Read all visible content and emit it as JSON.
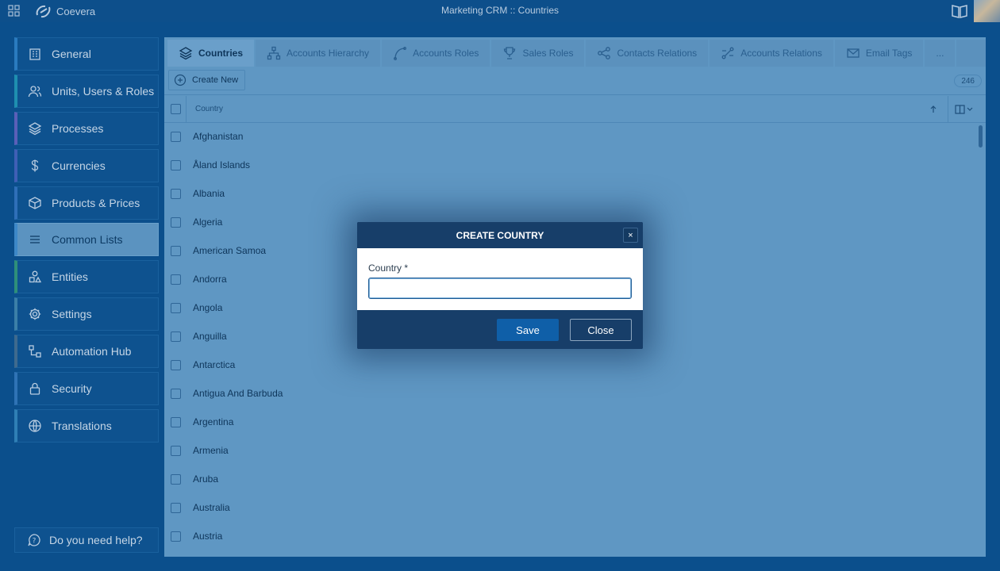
{
  "app": {
    "brand": "Coevera",
    "window_title": "Marketing CRM :: Countries"
  },
  "sidebar": {
    "items": [
      {
        "label": "General",
        "icon": "building-icon",
        "accent": "#2a7bbf"
      },
      {
        "label": "Units, Users & Roles",
        "icon": "users-icon",
        "accent": "#1e8fb0"
      },
      {
        "label": "Processes",
        "icon": "layers-icon",
        "accent": "#5a5fb8"
      },
      {
        "label": "Currencies",
        "icon": "dollar-icon",
        "accent": "#3f5fb5"
      },
      {
        "label": "Products & Prices",
        "icon": "box-icon",
        "accent": "#2f6fb8"
      },
      {
        "label": "Common Lists",
        "icon": "list-icon",
        "accent": "#3d88c8"
      },
      {
        "label": "Entities",
        "icon": "shapes-icon",
        "accent": "#2e8f7a"
      },
      {
        "label": "Settings",
        "icon": "gear-icon",
        "accent": "#3b7fa8"
      },
      {
        "label": "Automation Hub",
        "icon": "workflow-icon",
        "accent": "#3e6a8e"
      },
      {
        "label": "Security",
        "icon": "lock-icon",
        "accent": "#2f73b5"
      },
      {
        "label": "Translations",
        "icon": "globe-icon",
        "accent": "#2f7fb5"
      }
    ],
    "active_index": 5,
    "help_label": "Do you need help?"
  },
  "tabs": [
    {
      "label": "Countries",
      "icon": "layers-icon"
    },
    {
      "label": "Accounts Hierarchy",
      "icon": "hierarchy-icon"
    },
    {
      "label": "Accounts Roles",
      "icon": "curve-icon"
    },
    {
      "label": "Sales Roles",
      "icon": "trophy-icon"
    },
    {
      "label": "Contacts Relations",
      "icon": "share-icon"
    },
    {
      "label": "Accounts Relations",
      "icon": "relation-icon"
    },
    {
      "label": "Email Tags",
      "icon": "mail-icon"
    },
    {
      "label": "...",
      "icon": ""
    }
  ],
  "toolbar": {
    "create_label": "Create New",
    "count": "246"
  },
  "grid": {
    "column_header": "Country",
    "rows": [
      "Afghanistan",
      "Åland Islands",
      "Albania",
      "Algeria",
      "American Samoa",
      "Andorra",
      "Angola",
      "Anguilla",
      "Antarctica",
      "Antigua And Barbuda",
      "Argentina",
      "Armenia",
      "Aruba",
      "Australia",
      "Austria"
    ]
  },
  "modal": {
    "title": "CREATE COUNTRY",
    "close_glyph": "×",
    "field_label": "Country *",
    "field_value": "",
    "save_label": "Save",
    "close_label": "Close"
  },
  "colors": {
    "sidebar_bg": "#0e528f",
    "panel_bg": "#5f97c3",
    "modal_header": "#173e69",
    "save_button": "#0f5fa8"
  }
}
